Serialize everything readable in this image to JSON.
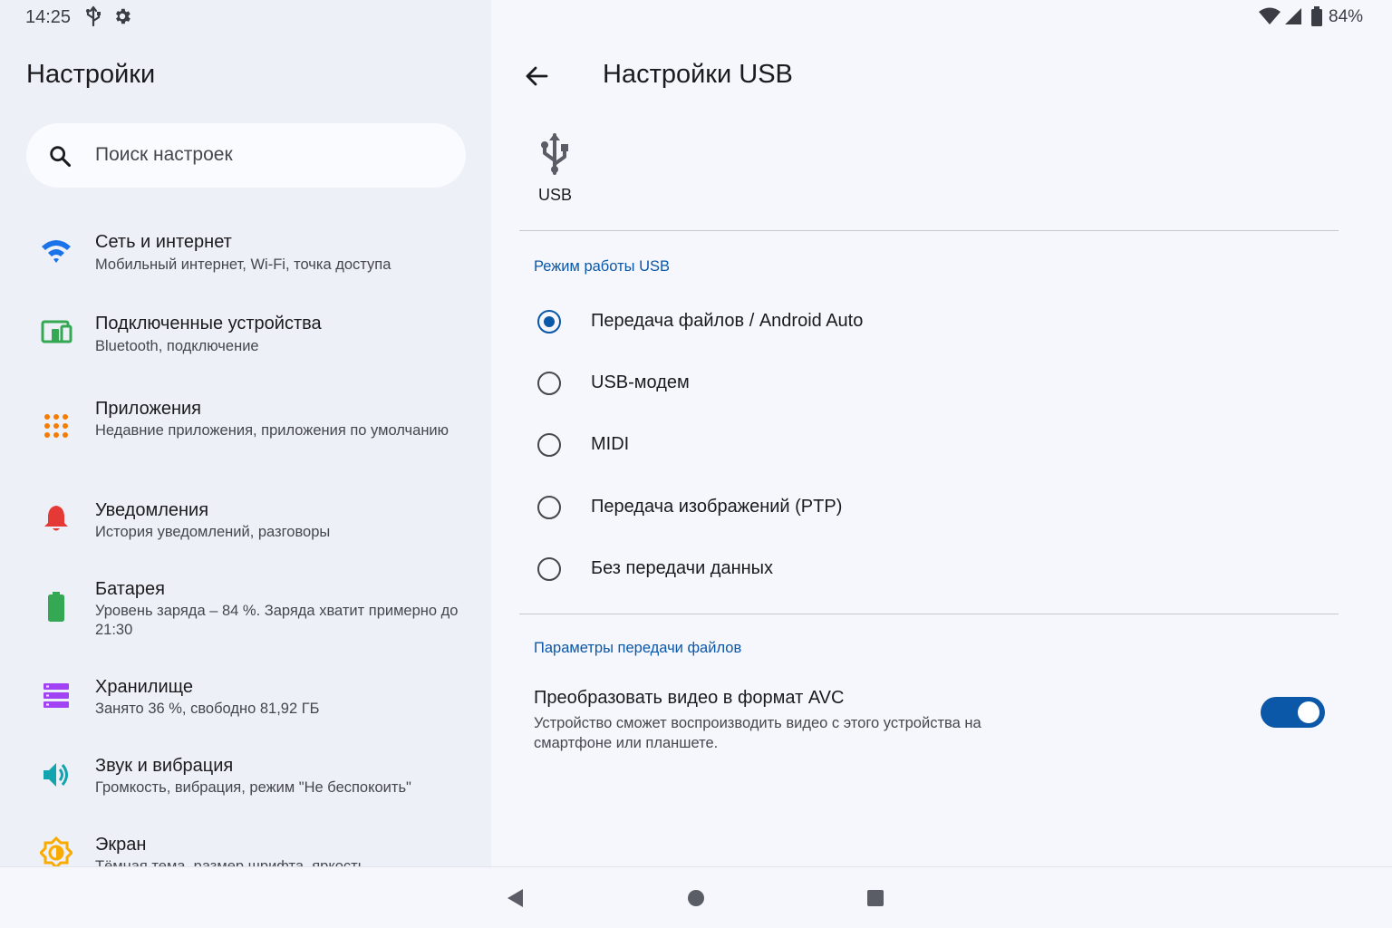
{
  "status_bar": {
    "time": "14:25",
    "battery_percent": "84%",
    "icons": [
      "usb-icon",
      "gear-icon",
      "wifi-signal-icon",
      "cell-signal-icon",
      "battery-icon"
    ]
  },
  "left_pane": {
    "title": "Настройки",
    "search": {
      "placeholder": "Поиск настроек"
    },
    "items": [
      {
        "title": "Сеть и интернет",
        "subtitle": "Мобильный интернет, Wi-Fi, точка доступа",
        "icon": "wifi-icon",
        "color": "#1a73e8"
      },
      {
        "title": "Подключенные устройства",
        "subtitle": "Bluetooth, подключение",
        "icon": "connected-devices-icon",
        "color": "#34a853"
      },
      {
        "title": "Приложения",
        "subtitle": "Недавние приложения, приложения по умолчанию",
        "icon": "apps-grid-icon",
        "color": "#f57c00"
      },
      {
        "title": "Уведомления",
        "subtitle": "История уведомлений, разговоры",
        "icon": "bell-icon",
        "color": "#e53935"
      },
      {
        "title": "Батарея",
        "subtitle": "Уровень заряда – 84 %. Заряда хватит примерно до 21:30",
        "icon": "battery-icon",
        "color": "#34a853"
      },
      {
        "title": "Хранилище",
        "subtitle": "Занято 36 %, свободно 81,92 ГБ",
        "icon": "storage-icon",
        "color": "#a142f4"
      },
      {
        "title": "Звук и вибрация",
        "subtitle": "Громкость, вибрация, режим \"Не беспокоить\"",
        "icon": "volume-icon",
        "color": "#12a4af"
      },
      {
        "title": "Экран",
        "subtitle": "Тёмная тема, размер шрифта, яркость",
        "icon": "brightness-icon",
        "color": "#f9ab00"
      }
    ]
  },
  "right_pane": {
    "title": "Настройки USB",
    "usb_label": "USB",
    "usb_mode": {
      "header": "Режим работы USB",
      "options": [
        {
          "label": "Передача файлов / Android Auto",
          "selected": true
        },
        {
          "label": "USB-модем",
          "selected": false
        },
        {
          "label": "MIDI",
          "selected": false
        },
        {
          "label": "Передача изображений (PTP)",
          "selected": false
        },
        {
          "label": "Без передачи данных",
          "selected": false
        }
      ]
    },
    "file_transfer": {
      "header": "Параметры передачи файлов",
      "avc_title": "Преобразовать видео в формат AVC",
      "avc_subtitle": "Устройство сможет воспроизводить видео с этого устройства на смартфоне или планшете.",
      "avc_enabled": true
    }
  },
  "nav_bar": {
    "buttons": [
      "back-nav-icon",
      "home-nav-icon",
      "recents-nav-icon"
    ]
  },
  "colors": {
    "accent": "#0b57a8",
    "left_background": "#eef0f7",
    "right_background": "#f6f7fc"
  }
}
